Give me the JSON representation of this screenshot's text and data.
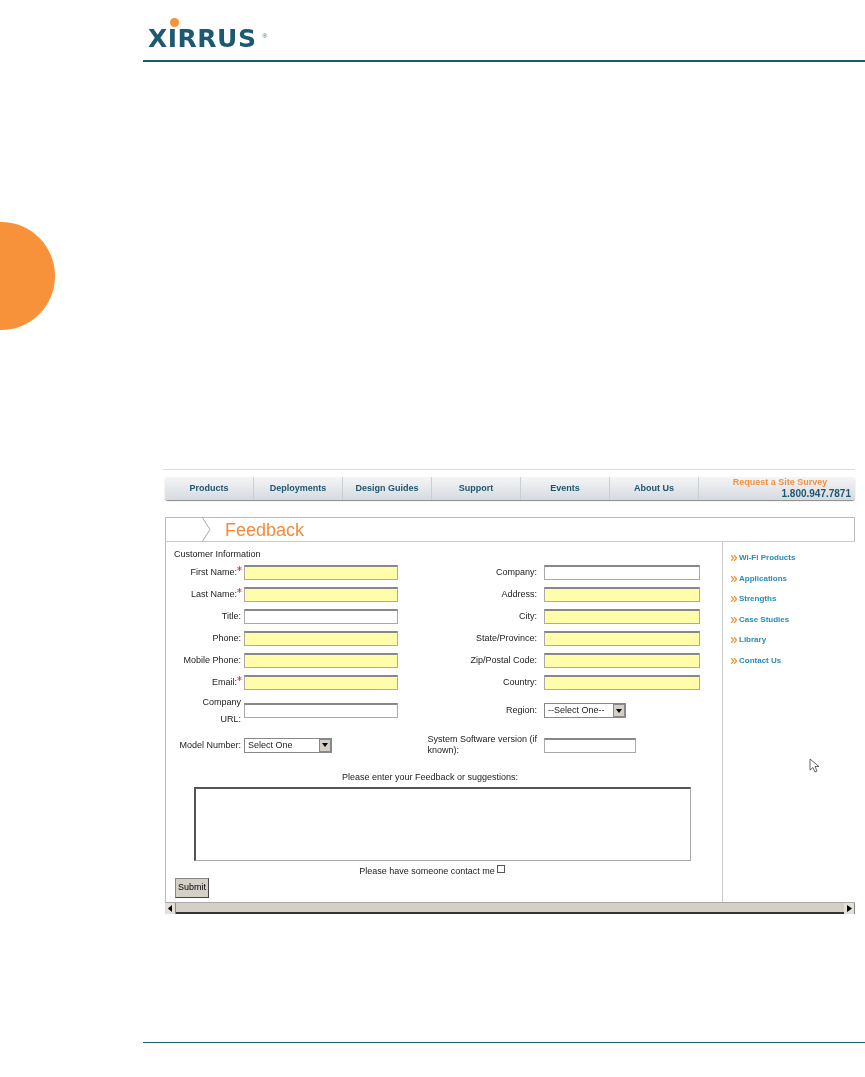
{
  "logo": {
    "text": "XIRRUS",
    "mark": "®"
  },
  "nav": {
    "items": [
      {
        "label": "Products"
      },
      {
        "label": "Deployments"
      },
      {
        "label": "Design Guides"
      },
      {
        "label": "Support"
      },
      {
        "label": "Events"
      },
      {
        "label": "About Us"
      }
    ],
    "cta": {
      "title": "Request a Site Survey",
      "phone": "1.800.947.7871"
    }
  },
  "page_title": "Feedback",
  "form": {
    "section_title": "Customer Information",
    "rows": [
      {
        "left": {
          "label": "First Name:",
          "required": true,
          "kind": "text",
          "highlighted": true
        },
        "right": {
          "label": "Company:",
          "required": false,
          "kind": "text",
          "highlighted": false
        }
      },
      {
        "left": {
          "label": "Last Name:",
          "required": true,
          "kind": "text",
          "highlighted": true
        },
        "right": {
          "label": "Address:",
          "required": false,
          "kind": "text",
          "highlighted": true
        }
      },
      {
        "left": {
          "label": "Title:",
          "required": false,
          "kind": "text",
          "highlighted": false
        },
        "right": {
          "label": "City:",
          "required": false,
          "kind": "text",
          "highlighted": true
        }
      },
      {
        "left": {
          "label": "Phone:",
          "required": false,
          "kind": "text",
          "highlighted": true
        },
        "right": {
          "label": "State/Province:",
          "required": false,
          "kind": "text",
          "highlighted": true
        }
      },
      {
        "left": {
          "label": "Mobile Phone:",
          "required": false,
          "kind": "text",
          "highlighted": true
        },
        "right": {
          "label": "Zip/Postal Code:",
          "required": false,
          "kind": "text",
          "highlighted": true
        }
      },
      {
        "left": {
          "label": "Email:",
          "required": true,
          "kind": "text",
          "highlighted": true
        },
        "right": {
          "label": "Country:",
          "required": false,
          "kind": "text",
          "highlighted": true
        }
      },
      {
        "left": {
          "label": "Company\nURL:",
          "required": false,
          "kind": "text",
          "highlighted": false
        },
        "right": {
          "label": "Region:",
          "required": false,
          "kind": "select",
          "value": "--Select One--"
        }
      },
      {
        "left": {
          "label": "Model Number:",
          "required": false,
          "kind": "select",
          "value": "Select One"
        },
        "right": {
          "label": "System Software version (if\nknown):",
          "required": false,
          "kind": "text",
          "highlighted": false
        }
      }
    ],
    "feedback_prompt": "Please enter your Feedback or suggestions:",
    "contact": {
      "label": "Please have someone contact me",
      "checked": false
    },
    "submit": "Submit"
  },
  "sidebar": {
    "links": [
      {
        "label": "Wi-Fi Products"
      },
      {
        "label": "Applications"
      },
      {
        "label": "Strengths"
      },
      {
        "label": "Case Studies"
      },
      {
        "label": "Library"
      },
      {
        "label": "Contact Us"
      }
    ]
  }
}
